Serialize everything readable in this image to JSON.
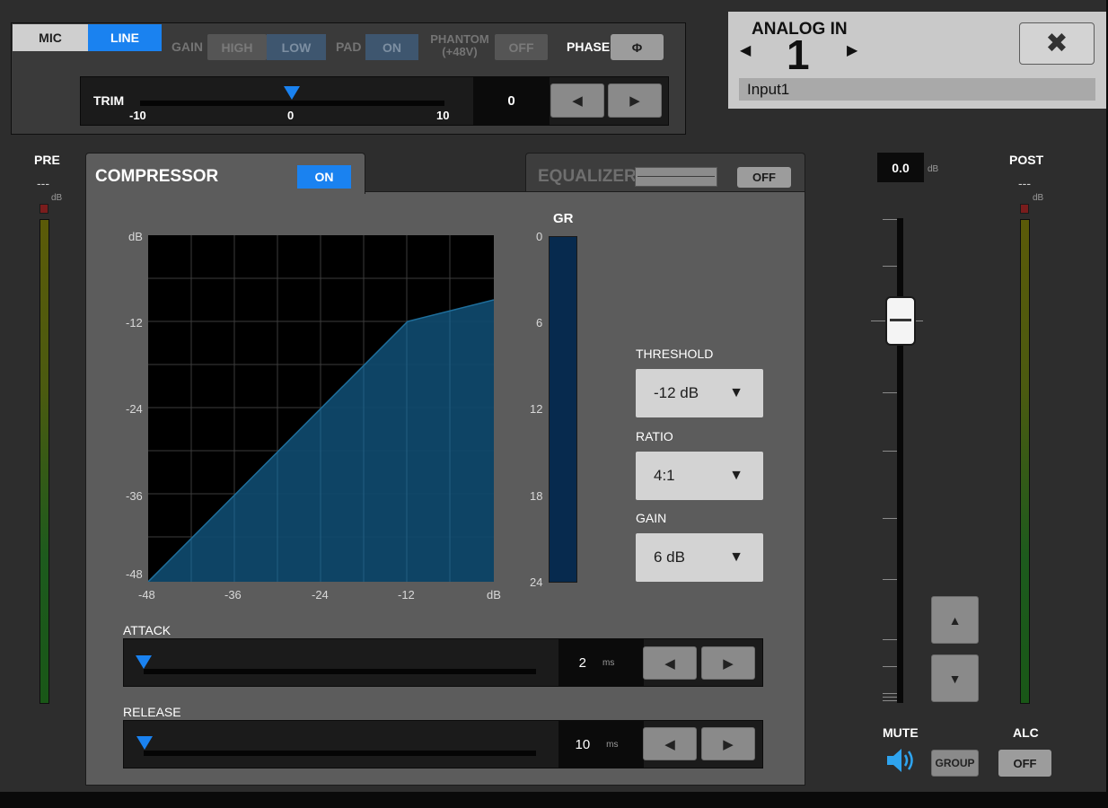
{
  "colors": {
    "accent_blue": "#1a82f0",
    "panel": "#2d2d2d",
    "graph_fill": "#0f4a6e",
    "gr_bar": "#072a4e"
  },
  "input": {
    "mic_label": "MIC",
    "line_label": "LINE",
    "gain_label": "GAIN",
    "gain_high": "HIGH",
    "gain_low": "LOW",
    "pad_label": "PAD",
    "pad_on": "ON",
    "phantom_label_1": "PHANTOM",
    "phantom_label_2": "(+48V)",
    "phantom_off": "OFF",
    "phase_label": "PHASE",
    "phase_button": "Φ",
    "trim_label": "TRIM",
    "trim_min": "-10",
    "trim_mid": "0",
    "trim_max": "10",
    "trim_value": "0"
  },
  "channel": {
    "title": "ANALOG IN",
    "number": "1",
    "name": "Input1",
    "close_icon": "close-icon"
  },
  "compressor": {
    "tab_label": "COMPRESSOR",
    "on_label": "ON",
    "graph": {
      "y_unit": "dB",
      "x_unit": "dB",
      "y_ticks": [
        "-12",
        "-24",
        "-36",
        "-48"
      ],
      "x_ticks": [
        "-48",
        "-36",
        "-24",
        "-12"
      ]
    },
    "gr": {
      "label": "GR",
      "ticks": [
        "0",
        "6",
        "12",
        "18",
        "24"
      ]
    },
    "threshold_label": "THRESHOLD",
    "threshold_value": "-12 dB",
    "ratio_label": "RATIO",
    "ratio_value": "4:1",
    "gain_label": "GAIN",
    "gain_value": "6 dB",
    "attack_label": "ATTACK",
    "attack_value": "2",
    "attack_unit": "ms",
    "release_label": "RELEASE",
    "release_value": "10",
    "release_unit": "ms"
  },
  "equalizer": {
    "tab_label": "EQUALIZER",
    "off_label": "OFF"
  },
  "meters": {
    "pre_label": "PRE",
    "pre_value": "---",
    "pre_unit": "dB",
    "post_label": "POST",
    "post_value": "---",
    "post_unit": "dB"
  },
  "fader": {
    "value": "0.0",
    "unit": "dB"
  },
  "footer": {
    "mute_label": "MUTE",
    "group_label": "GROUP",
    "alc_label": "ALC",
    "alc_value": "OFF"
  }
}
